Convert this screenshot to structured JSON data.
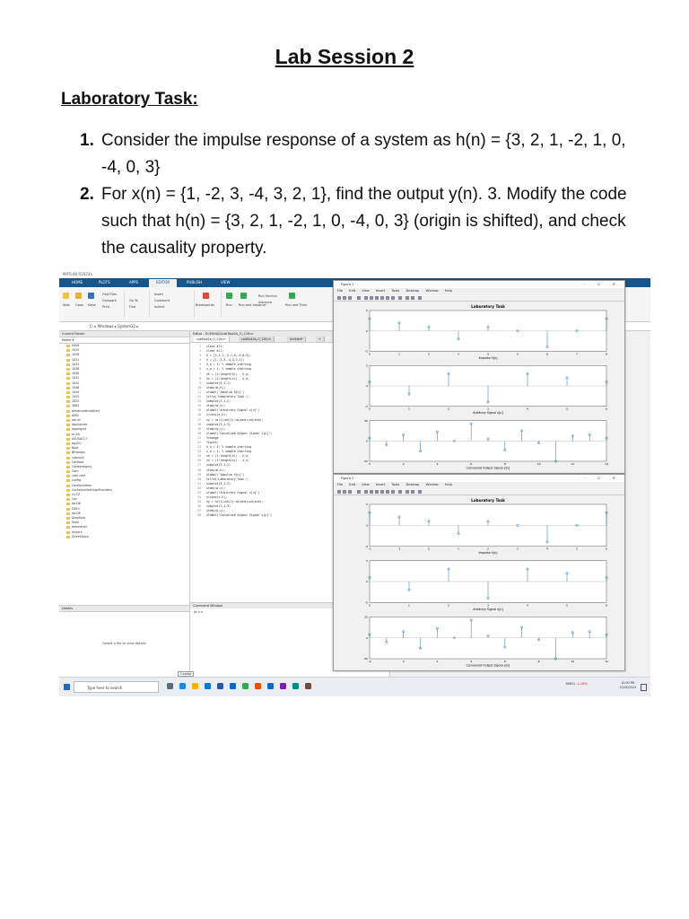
{
  "document": {
    "title": "Lab Session 2",
    "subheading": "Laboratory Task:",
    "tasks": [
      {
        "num": "1.",
        "text": "Consider the impulse response of a system as h(n) = {3, 2, 1, -2, 1, 0, -4, 0, 3}"
      },
      {
        "num": "2.",
        "text": "For x(n) = {1, -2, 3, -4, 3, 2, 1}, find the output y(n). 3. Modify the code such that h(n) = {3, 2, 1, -2, 1, 0, -4, 0, 3} (origin is shifted), and check the causality property."
      }
    ]
  },
  "matlab": {
    "window_title": "MATLAB R2023a",
    "ribbon_tabs": [
      "HOME",
      "PLOTS",
      "APPS",
      "EDITOR",
      "PUBLISH",
      "VIEW"
    ],
    "active_tab": "EDITOR",
    "ribbon_buttons": [
      "New",
      "Open",
      "Save",
      "Find Files",
      "Compare",
      "Print",
      "Go To",
      "Find",
      "Insert",
      "Comment",
      "Indent",
      "Breakpoints",
      "Run",
      "Run and Advance",
      "Run Section",
      "Advance",
      "Run and Time"
    ],
    "path": "C: ▸ Windows ▸ System32 ▸",
    "current_folder_label": "Current Folder",
    "name_column": "Name ▾",
    "folders": [
      "0409",
      "1025",
      "1028",
      "1031",
      "1033",
      "1036",
      "1040",
      "1041",
      "1042",
      "1046",
      "1049",
      "1055",
      "2052",
      "3082",
      "AdvancedInstallers",
      "AMD",
      "am-et",
      "AppLocker",
      "appmgmt",
      "ar-SA",
      "ASUSACCI",
      "bg-BG",
      "Boot",
      "Bthprops",
      "catroot2",
      "CatRoot",
      "CodeIntegrity",
      "Com",
      "com.conf",
      "config",
      "Configuration",
      "ContainerSettingsProviders",
      "cs-CZ",
      "Csc",
      "da-DK",
      "DDFs",
      "de-DE",
      "DiagSvcs",
      "Dism",
      "downlevel",
      "drivers",
      "DriverStore"
    ],
    "details_label": "Details",
    "details_hint": "Select a file to view details",
    "editor_header": "Editor - D:\\FAHAD\\LabTask2a_O_126.m",
    "editor_tabs": [
      "LabTask2a_O_126.m",
      "LabTask2b_O_126.m",
      "Untitled*",
      "+"
    ],
    "code_lines": [
      {
        "n": "1",
        "code": "close all;"
      },
      {
        "n": "2",
        "code": "clear all;"
      },
      {
        "n": "3",
        "code": "h = [3,2,1,-2,1,0,-4,0,3];"
      },
      {
        "n": "4",
        "code": "x = [1,-2,3,-4,3,2,1];"
      },
      {
        "n": "5",
        "code": "h_o = 1; % sample starting"
      },
      {
        "n": "6",
        "code": "x_o = 1; % sample starting"
      },
      {
        "n": "7",
        "code": "nh = (1:length(h)) - h_o;"
      },
      {
        "n": "8",
        "code": "nx = (1:length(x)) - x_o;"
      },
      {
        "n": "9",
        "code": "subplot(3,1,1)"
      },
      {
        "n": "10",
        "code": "stem(nh,h);"
      },
      {
        "n": "11",
        "code": "xlabel('Impulse h[n]')"
      },
      {
        "n": "12",
        "code": "title('Laboratory Task')"
      },
      {
        "n": "13",
        "code": "subplot(3,1,2)"
      },
      {
        "n": "14",
        "code": "stem(nx,x);"
      },
      {
        "n": "15",
        "code": "xlabel('Arbitrary Signal x[n]')"
      },
      {
        "n": "16",
        "code": "y=conv(x,h);"
      },
      {
        "n": "17",
        "code": "ny = nx(1)+nh(1):nx(end)+nh(end);"
      },
      {
        "n": "18",
        "code": "subplot(3,1,3)"
      },
      {
        "n": "19",
        "code": "stem(ny,y);"
      },
      {
        "n": "20",
        "code": "xlabel('Convolved Output Signal y[n]')"
      },
      {
        "n": "21",
        "code": "%change"
      },
      {
        "n": "22",
        "code": "figure;"
      },
      {
        "n": "23",
        "code": "h_o = 3; % sample starting"
      },
      {
        "n": "24",
        "code": "x_o = 1; % sample starting"
      },
      {
        "n": "25",
        "code": "nh = (1:length(h)) - h_o;"
      },
      {
        "n": "26",
        "code": "nx = (1:length(x)) - x_o;"
      },
      {
        "n": "27",
        "code": "subplot(3,1,1)"
      },
      {
        "n": "28",
        "code": "stem(nh,h);"
      },
      {
        "n": "29",
        "code": "xlabel('Impulse h[n]')"
      },
      {
        "n": "30",
        "code": "title('Laboratory Task')"
      },
      {
        "n": "31",
        "code": "subplot(3,1,2)"
      },
      {
        "n": "32",
        "code": "stem(nx,x);"
      },
      {
        "n": "33",
        "code": "xlabel('Arbitrary Signal x[n]')"
      },
      {
        "n": "34",
        "code": "y=conv(x,h);"
      },
      {
        "n": "35",
        "code": "ny = nx(1)+nh(1):nx(end)+nh(end);"
      },
      {
        "n": "36",
        "code": "subplot(3,1,3)"
      },
      {
        "n": "37",
        "code": "stem(ny,y);"
      },
      {
        "n": "38",
        "code": "xlabel('Convolved Output Signal y[n]')"
      }
    ],
    "command_window_label": "Command Window",
    "command_prompt": "fx >>",
    "tooltip": "Copilot"
  },
  "figures": [
    {
      "title": "Figure 1",
      "menu": [
        "File",
        "Edit",
        "View",
        "Insert",
        "Tools",
        "Desktop",
        "Window",
        "Help"
      ],
      "plot_title": "Laboratory Task",
      "xlabels": [
        "Impulse h[n]",
        "Arbitrary Signal x[n]",
        "Convolved Output Signal y[n]"
      ]
    },
    {
      "title": "Figure 2",
      "menu": [
        "File",
        "Edit",
        "View",
        "Insert",
        "Tools",
        "Desktop",
        "Window",
        "Help"
      ],
      "plot_title": "Laboratory Task",
      "xlabels": [
        "Impulse h[n]",
        "Arbitrary Signal x[n]",
        "Convolved Output Signal y[n]"
      ]
    }
  ],
  "taskbar": {
    "search_placeholder": "Type here to search",
    "stock_label": "AMD1",
    "stock_change": "-1.26%",
    "time": "10:00 PM",
    "date": "03/05/2024"
  },
  "colors": {
    "matlab_blue": "#16558a",
    "stem": "#1f77b4",
    "tab_text": "#ffffff"
  }
}
